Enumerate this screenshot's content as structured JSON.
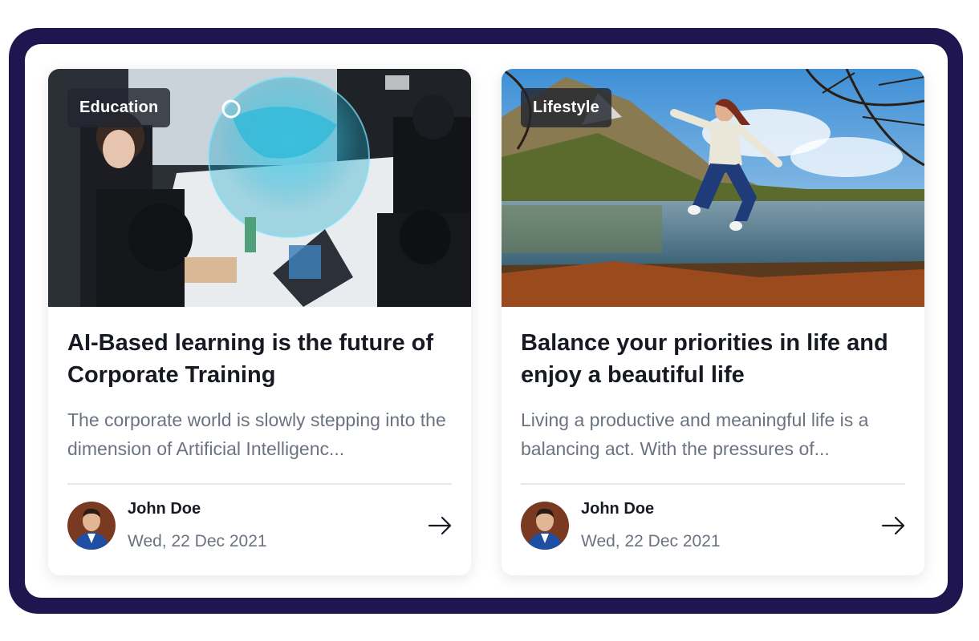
{
  "posts": [
    {
      "tag": "Education",
      "title": "AI-Based learning is the future of Corporate Training",
      "excerpt": "The corporate world is slowly stepping into the dimension of Artificial Intelligenc...",
      "author": "John Doe",
      "date": "Wed, 22 Dec 2021",
      "image_icon": "business-team-photo"
    },
    {
      "tag": "Lifestyle",
      "title": "Balance your priorities in life and enjoy a beautiful life",
      "excerpt": "Living a productive and meaningful life is a balancing act. With the pressures of...",
      "author": "John Doe",
      "date": "Wed, 22 Dec 2021",
      "image_icon": "lake-jump-photo"
    }
  ],
  "colors": {
    "frame": "#1f1650",
    "card_background": "#ffffff",
    "title_text": "#171a23",
    "muted_text": "#6b7380",
    "tag_background": "#23262f"
  }
}
